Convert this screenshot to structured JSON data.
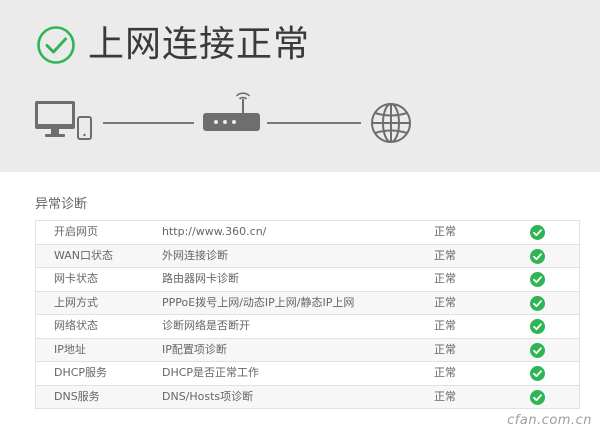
{
  "header": {
    "status_text": "上网连接正常"
  },
  "topology": {
    "nodes": [
      "computer-icon",
      "phone-icon",
      "router-icon",
      "globe-icon"
    ]
  },
  "section": {
    "title": "异常诊断"
  },
  "diagnostics": [
    {
      "item": "开启网页",
      "desc": "http://www.360.cn/",
      "status": "正常"
    },
    {
      "item": "WAN口状态",
      "desc": "外网连接诊断",
      "status": "正常"
    },
    {
      "item": "网卡状态",
      "desc": "路由器网卡诊断",
      "status": "正常"
    },
    {
      "item": "上网方式",
      "desc": "PPPoE拨号上网/动态IP上网/静态IP上网",
      "status": "正常"
    },
    {
      "item": "网络状态",
      "desc": "诊断网络是否断开",
      "status": "正常"
    },
    {
      "item": "IP地址",
      "desc": "IP配置项诊断",
      "status": "正常"
    },
    {
      "item": "DHCP服务",
      "desc": "DHCP是否正常工作",
      "status": "正常"
    },
    {
      "item": "DNS服务",
      "desc": "DNS/Hosts项诊断",
      "status": "正常"
    }
  ],
  "watermark": "cfan.com.cn",
  "colors": {
    "ok_green": "#2fb554",
    "banner_bg": "#ebebeb",
    "icon_gray": "#6e6e6e"
  }
}
